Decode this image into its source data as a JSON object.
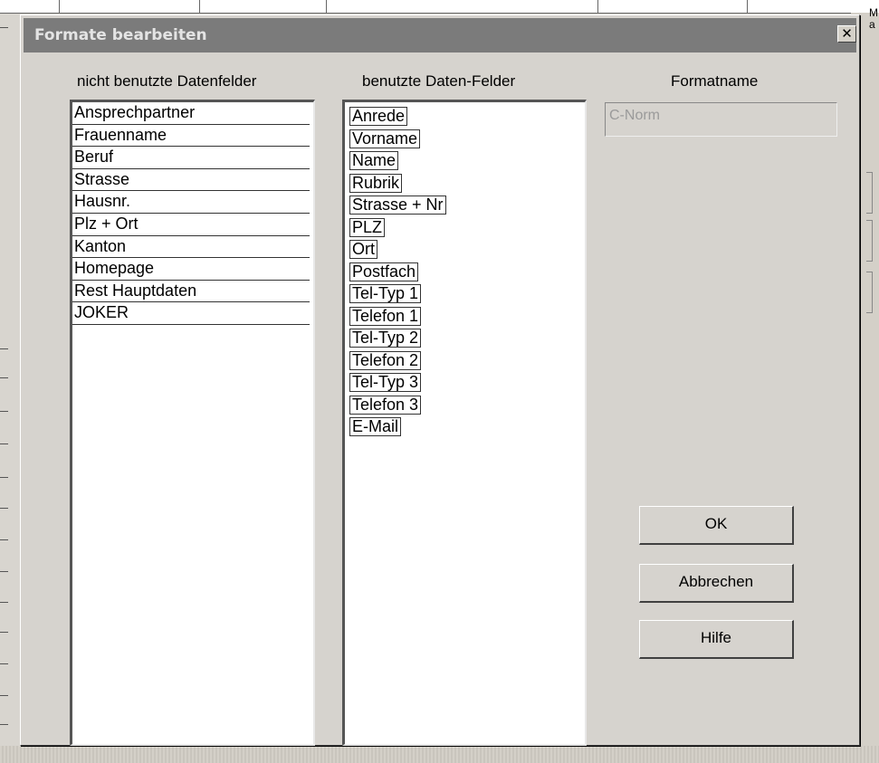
{
  "dialog": {
    "title": "Formate bearbeiten",
    "close_label": "✕"
  },
  "background": {
    "right_text_1": "M.",
    "right_text_2": "a"
  },
  "unused_fields": {
    "label": "nicht benutzte Datenfelder",
    "items": [
      "Ansprechpartner",
      "Frauenname",
      "Beruf",
      "Strasse",
      "Hausnr.",
      "Plz + Ort",
      "Kanton",
      "Homepage",
      "Rest Hauptdaten",
      "JOKER"
    ]
  },
  "used_fields": {
    "label": "benutzte Daten-Felder",
    "items": [
      "Anrede",
      "Vorname",
      "Name",
      "Rubrik",
      "Strasse + Nr",
      "PLZ",
      "Ort",
      "Postfach",
      "Tel-Typ 1",
      "Telefon 1",
      "Tel-Typ 2",
      "Telefon 2",
      "Tel-Typ 3",
      "Telefon 3",
      "E-Mail"
    ]
  },
  "format": {
    "label": "Formatname",
    "value": "C-Norm"
  },
  "buttons": {
    "ok": "OK",
    "cancel": "Abbrechen",
    "help": "Hilfe"
  }
}
